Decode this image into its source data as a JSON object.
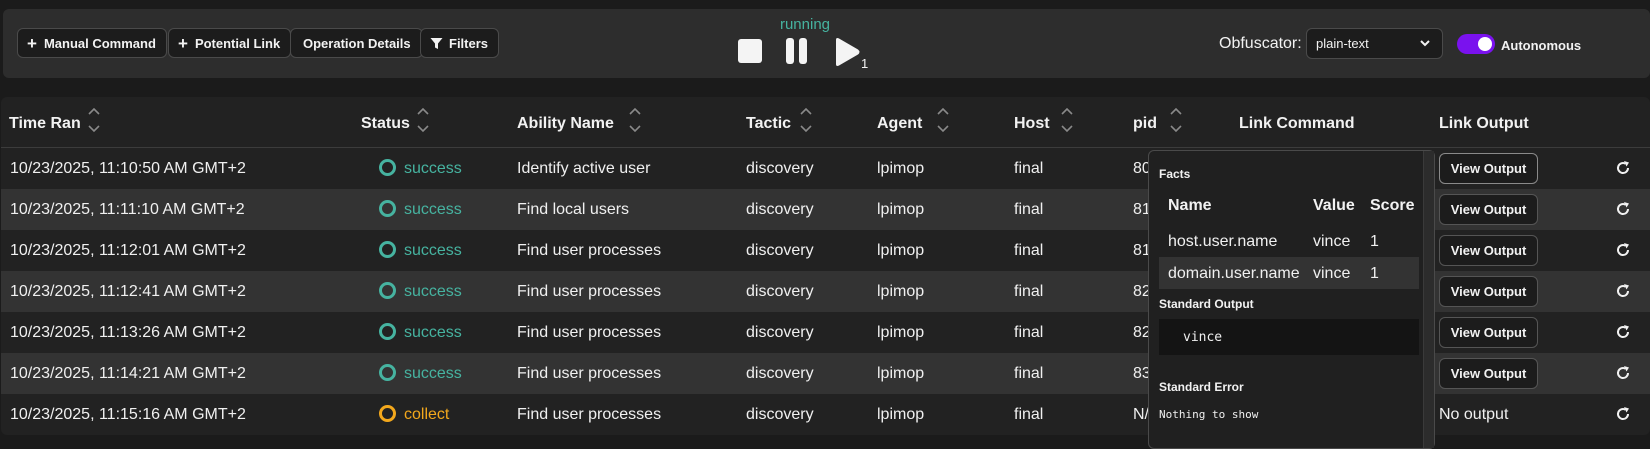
{
  "toolbar": {
    "manual_command": "Manual Command",
    "potential_link": "Potential Link",
    "operation_details": "Operation Details",
    "filters": "Filters",
    "state": "running",
    "play_count": "1",
    "obfuscator_label": "Obfuscator:",
    "obfuscator_value": "plain-text",
    "autonomous_label": "Autonomous",
    "autonomous_on": true,
    "accent_color": "#7a12ee"
  },
  "table": {
    "headers": {
      "time": "Time Ran",
      "status": "Status",
      "ability": "Ability Name",
      "tactic": "Tactic",
      "agent": "Agent",
      "host": "Host",
      "pid": "pid",
      "link_command": "Link Command",
      "link_output": "Link Output"
    },
    "rows": [
      {
        "time": "10/23/2025, 11:10:50 AM GMT+2",
        "status": "success",
        "ability": "Identify active user",
        "tactic": "discovery",
        "agent": "lpimop",
        "host": "final",
        "pid": "80",
        "output": "View Output"
      },
      {
        "time": "10/23/2025, 11:11:10 AM GMT+2",
        "status": "success",
        "ability": "Find local users",
        "tactic": "discovery",
        "agent": "lpimop",
        "host": "final",
        "pid": "81",
        "output": "View Output"
      },
      {
        "time": "10/23/2025, 11:12:01 AM GMT+2",
        "status": "success",
        "ability": "Find user processes",
        "tactic": "discovery",
        "agent": "lpimop",
        "host": "final",
        "pid": "81",
        "output": "View Output"
      },
      {
        "time": "10/23/2025, 11:12:41 AM GMT+2",
        "status": "success",
        "ability": "Find user processes",
        "tactic": "discovery",
        "agent": "lpimop",
        "host": "final",
        "pid": "82",
        "output": "View Output"
      },
      {
        "time": "10/23/2025, 11:13:26 AM GMT+2",
        "status": "success",
        "ability": "Find user processes",
        "tactic": "discovery",
        "agent": "lpimop",
        "host": "final",
        "pid": "82",
        "output": "View Output"
      },
      {
        "time": "10/23/2025, 11:14:21 AM GMT+2",
        "status": "success",
        "ability": "Find user processes",
        "tactic": "discovery",
        "agent": "lpimop",
        "host": "final",
        "pid": "83",
        "output": "View Output"
      },
      {
        "time": "10/23/2025, 11:15:16 AM GMT+2",
        "status": "collect",
        "ability": "Find user processes",
        "tactic": "discovery",
        "agent": "lpimop",
        "host": "final",
        "pid": "N/",
        "output": "No output"
      }
    ],
    "status_colors": {
      "success": "#46b3a0",
      "collect": "#f3a81c"
    }
  },
  "popover": {
    "facts_title": "Facts",
    "facts_headers": {
      "name": "Name",
      "value": "Value",
      "score": "Score"
    },
    "facts": [
      {
        "name": "host.user.name",
        "value": "vince",
        "score": "1"
      },
      {
        "name": "domain.user.name",
        "value": "vince",
        "score": "1"
      }
    ],
    "stdout_title": "Standard Output",
    "stdout": "vince",
    "stderr_title": "Standard Error",
    "stderr": "Nothing to show"
  }
}
